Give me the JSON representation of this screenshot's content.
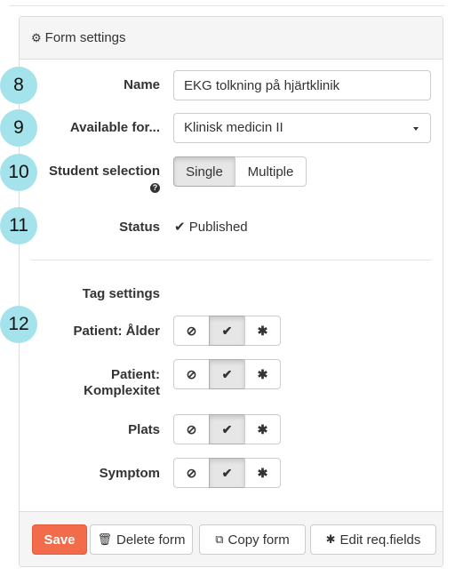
{
  "panel": {
    "title": "Form settings",
    "title_icon": "gear-icon"
  },
  "steps": [
    "8",
    "9",
    "10",
    "11",
    "12"
  ],
  "fields": {
    "name": {
      "label": "Name",
      "value": "EKG tolkning på hjärtklinik"
    },
    "available_for": {
      "label": "Available for...",
      "selected": "Klinisk medicin II"
    },
    "student_selection": {
      "label": "Student selection",
      "options": [
        "Single",
        "Multiple"
      ],
      "selected": "Single",
      "help_icon": "question-circle-icon"
    },
    "status": {
      "label": "Status",
      "value": "Published",
      "icon": "check-icon"
    }
  },
  "tag_settings": {
    "heading": "Tag settings",
    "tags": [
      {
        "label": "Patient: Ålder",
        "selected": "check"
      },
      {
        "label_line1": "Patient:",
        "label_line2": "Komplexitet",
        "selected": "check"
      },
      {
        "label": "Plats",
        "selected": "check"
      },
      {
        "label": "Symptom",
        "selected": "check"
      }
    ],
    "option_icons": [
      "ban-icon",
      "check-icon",
      "asterisk-icon"
    ],
    "option_glyphs": [
      "⊘",
      "✔",
      "✱"
    ]
  },
  "footer": {
    "save": "Save",
    "delete": "Delete form",
    "copy": "Copy form",
    "edit_req": "Edit req.fields"
  },
  "colors": {
    "accent_save": "#f26b4a",
    "step_circle": "#a4e3ec",
    "panel_header_bg": "#f5f5f5"
  }
}
